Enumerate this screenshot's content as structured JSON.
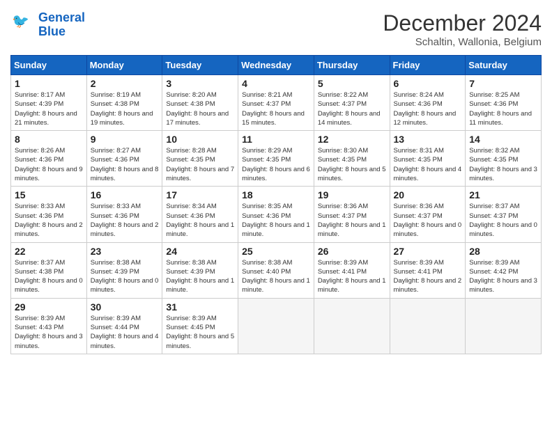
{
  "header": {
    "logo_general": "General",
    "logo_blue": "Blue",
    "month_title": "December 2024",
    "subtitle": "Schaltin, Wallonia, Belgium"
  },
  "weekdays": [
    "Sunday",
    "Monday",
    "Tuesday",
    "Wednesday",
    "Thursday",
    "Friday",
    "Saturday"
  ],
  "weeks": [
    [
      {
        "num": "1",
        "sunrise": "8:17 AM",
        "sunset": "4:39 PM",
        "daylight": "8 hours and 21 minutes."
      },
      {
        "num": "2",
        "sunrise": "8:19 AM",
        "sunset": "4:38 PM",
        "daylight": "8 hours and 19 minutes."
      },
      {
        "num": "3",
        "sunrise": "8:20 AM",
        "sunset": "4:38 PM",
        "daylight": "8 hours and 17 minutes."
      },
      {
        "num": "4",
        "sunrise": "8:21 AM",
        "sunset": "4:37 PM",
        "daylight": "8 hours and 15 minutes."
      },
      {
        "num": "5",
        "sunrise": "8:22 AM",
        "sunset": "4:37 PM",
        "daylight": "8 hours and 14 minutes."
      },
      {
        "num": "6",
        "sunrise": "8:24 AM",
        "sunset": "4:36 PM",
        "daylight": "8 hours and 12 minutes."
      },
      {
        "num": "7",
        "sunrise": "8:25 AM",
        "sunset": "4:36 PM",
        "daylight": "8 hours and 11 minutes."
      }
    ],
    [
      {
        "num": "8",
        "sunrise": "8:26 AM",
        "sunset": "4:36 PM",
        "daylight": "8 hours and 9 minutes."
      },
      {
        "num": "9",
        "sunrise": "8:27 AM",
        "sunset": "4:36 PM",
        "daylight": "8 hours and 8 minutes."
      },
      {
        "num": "10",
        "sunrise": "8:28 AM",
        "sunset": "4:35 PM",
        "daylight": "8 hours and 7 minutes."
      },
      {
        "num": "11",
        "sunrise": "8:29 AM",
        "sunset": "4:35 PM",
        "daylight": "8 hours and 6 minutes."
      },
      {
        "num": "12",
        "sunrise": "8:30 AM",
        "sunset": "4:35 PM",
        "daylight": "8 hours and 5 minutes."
      },
      {
        "num": "13",
        "sunrise": "8:31 AM",
        "sunset": "4:35 PM",
        "daylight": "8 hours and 4 minutes."
      },
      {
        "num": "14",
        "sunrise": "8:32 AM",
        "sunset": "4:35 PM",
        "daylight": "8 hours and 3 minutes."
      }
    ],
    [
      {
        "num": "15",
        "sunrise": "8:33 AM",
        "sunset": "4:36 PM",
        "daylight": "8 hours and 2 minutes."
      },
      {
        "num": "16",
        "sunrise": "8:33 AM",
        "sunset": "4:36 PM",
        "daylight": "8 hours and 2 minutes."
      },
      {
        "num": "17",
        "sunrise": "8:34 AM",
        "sunset": "4:36 PM",
        "daylight": "8 hours and 1 minute."
      },
      {
        "num": "18",
        "sunrise": "8:35 AM",
        "sunset": "4:36 PM",
        "daylight": "8 hours and 1 minute."
      },
      {
        "num": "19",
        "sunrise": "8:36 AM",
        "sunset": "4:37 PM",
        "daylight": "8 hours and 1 minute."
      },
      {
        "num": "20",
        "sunrise": "8:36 AM",
        "sunset": "4:37 PM",
        "daylight": "8 hours and 0 minutes."
      },
      {
        "num": "21",
        "sunrise": "8:37 AM",
        "sunset": "4:37 PM",
        "daylight": "8 hours and 0 minutes."
      }
    ],
    [
      {
        "num": "22",
        "sunrise": "8:37 AM",
        "sunset": "4:38 PM",
        "daylight": "8 hours and 0 minutes."
      },
      {
        "num": "23",
        "sunrise": "8:38 AM",
        "sunset": "4:39 PM",
        "daylight": "8 hours and 0 minutes."
      },
      {
        "num": "24",
        "sunrise": "8:38 AM",
        "sunset": "4:39 PM",
        "daylight": "8 hours and 1 minute."
      },
      {
        "num": "25",
        "sunrise": "8:38 AM",
        "sunset": "4:40 PM",
        "daylight": "8 hours and 1 minute."
      },
      {
        "num": "26",
        "sunrise": "8:39 AM",
        "sunset": "4:41 PM",
        "daylight": "8 hours and 1 minute."
      },
      {
        "num": "27",
        "sunrise": "8:39 AM",
        "sunset": "4:41 PM",
        "daylight": "8 hours and 2 minutes."
      },
      {
        "num": "28",
        "sunrise": "8:39 AM",
        "sunset": "4:42 PM",
        "daylight": "8 hours and 3 minutes."
      }
    ],
    [
      {
        "num": "29",
        "sunrise": "8:39 AM",
        "sunset": "4:43 PM",
        "daylight": "8 hours and 3 minutes."
      },
      {
        "num": "30",
        "sunrise": "8:39 AM",
        "sunset": "4:44 PM",
        "daylight": "8 hours and 4 minutes."
      },
      {
        "num": "31",
        "sunrise": "8:39 AM",
        "sunset": "4:45 PM",
        "daylight": "8 hours and 5 minutes."
      },
      null,
      null,
      null,
      null
    ]
  ]
}
